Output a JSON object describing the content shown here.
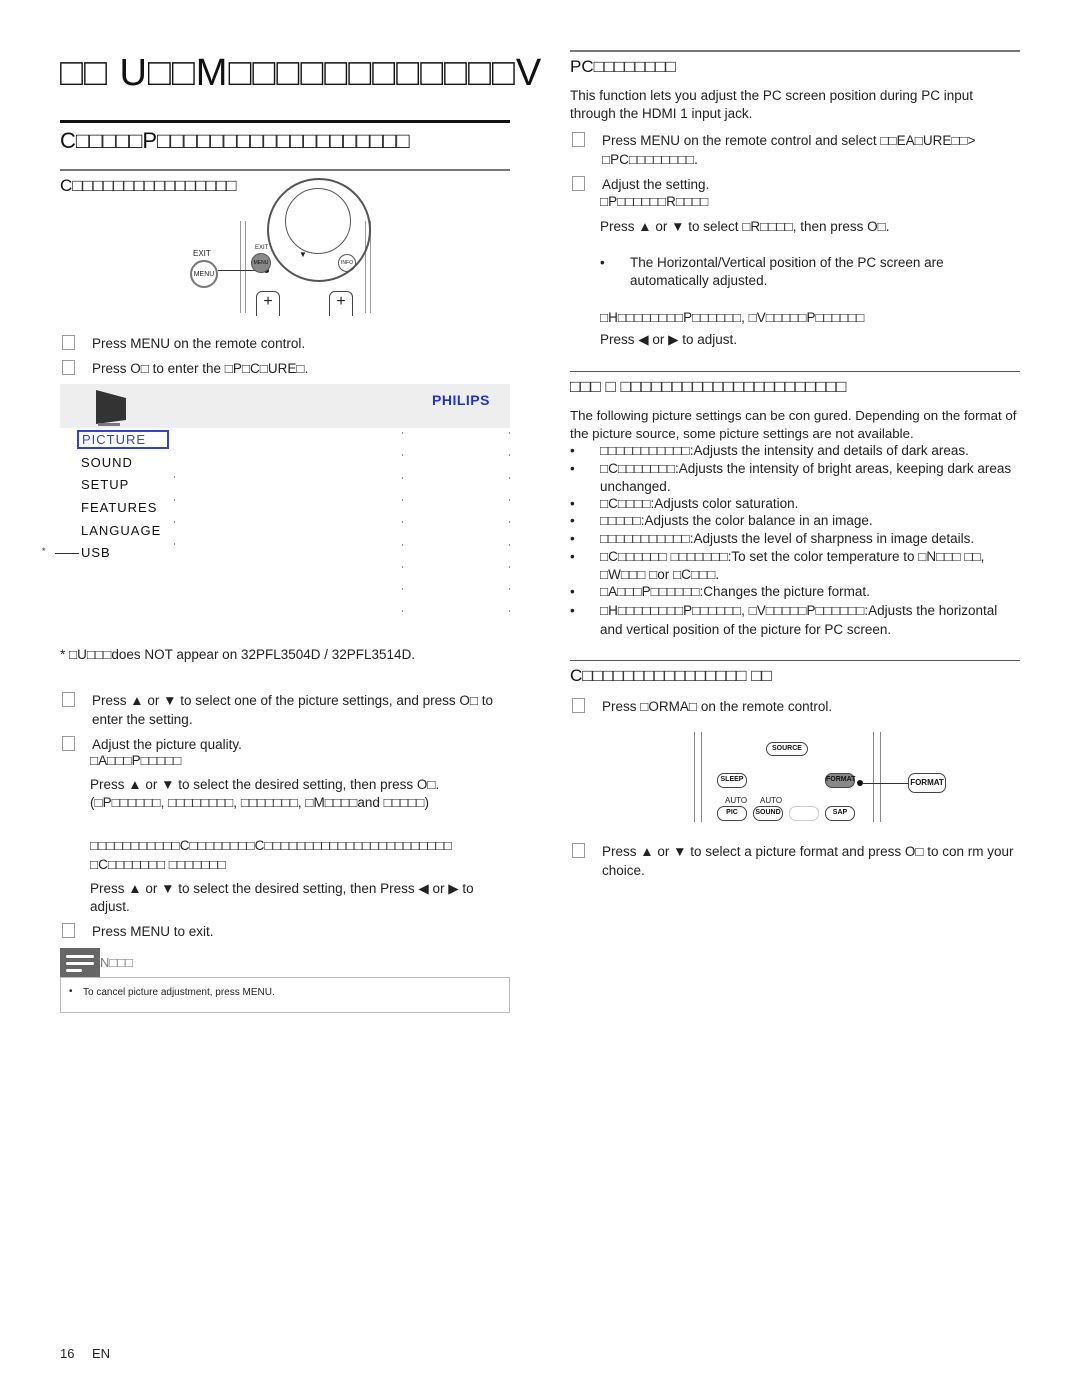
{
  "page": {
    "title": "□□ U□□M□□□□□□□□□□□□V",
    "footer_page": "16",
    "footer_lang": "EN"
  },
  "left": {
    "section_title": "C□□□□□P□□□□□□□□□□□□□□□□□□□",
    "subsection_title": "C□□□□□□□□□□□□□□□□",
    "remote1": {
      "exit_outer": "EXIT",
      "menu_outer": "MENU",
      "exit_inner": "EXIT",
      "menu_inner": "MENU",
      "info": "INFO",
      "down_arrow": "▼",
      "plus": "+"
    },
    "steps_a": [
      "Press MENU on the remote control.",
      "Press O□ to enter the □P□C□URE□."
    ],
    "menu": {
      "brand": "PHILIPS",
      "items": [
        "PICTURE",
        "SOUND",
        "SETUP",
        "FEATURES",
        "LANGUAGE",
        "USB"
      ],
      "selected": "PICTURE",
      "usb_marker": "*",
      "accent": "#3344cc"
    },
    "usb_footnote": "* □U□□□does NOT appear on 32PFL3504D / 32PFL3514D.",
    "steps_b": [
      "Press ▲ or ▼ to select one of the picture settings, and press O□ to enter the setting.",
      "Adjust the picture quality."
    ],
    "auto_picture_label": "□A□□□P□□□□□",
    "auto_picture_text": "Press ▲ or ▼ to select the desired setting, then press O□.",
    "auto_picture_options": "(□P□□□□□□, □□□□□□□□, □□□□□□□, □M□□□□and □□□□□)",
    "other_settings_label": "□□□□□□□□□□□C□□□□□□□□C□□□□□□□□□□□□□□□□□□□□□□□",
    "other_settings_label2": "□C□□□□□□□ □□□□□□□",
    "other_settings_text": "Press ▲ or ▼ to select the desired setting, then Press ◀ or ▶ to adjust.",
    "step_exit": "Press MENU to exit.",
    "note_title": "N□□□",
    "note_text": "To cancel picture adjustment, press MENU."
  },
  "right": {
    "pc_title": "PC□□□□□□□□",
    "pc_intro": "This function lets you adjust the PC screen position during PC input through the HDMI 1 input jack.",
    "pc_step1": "Press MENU on the remote control and select □□EA□URE□□> □PC□□□□□□□□.",
    "pc_step2": "Adjust the setting.",
    "pc_reset_label": "□P□□□□□□R□□□□",
    "pc_reset_text": "Press ▲ or ▼ to select □R□□□□, then press O□.",
    "pc_reset_bullet": "The Horizontal/Vertical position of the PC screen are automatically adjusted.",
    "pc_pos_label": "□H□□□□□□□□P□□□□□□, □V□□□□□P□□□□□□",
    "pc_pos_text": "Press ◀ or ▶ to adjust.",
    "more_title": "□□□ □ □□□□□□□□□□□□□□□□□□□□□□",
    "more_intro": "The following picture settings can be con gured. Depending on the format of the picture source, some picture settings are not available.",
    "more_bullets": [
      "□□□□□□□□□□□:Adjusts the intensity and details of dark areas.",
      "□C□□□□□□□:Adjusts the intensity of bright areas, keeping dark areas unchanged.",
      "□C□□□□:Adjusts color saturation.",
      "□□□□□:Adjusts the color balance in an image.",
      "□□□□□□□□□□□:Adjusts the level of sharpness in image details.",
      "□C□□□□□□ □□□□□□□:To set the color temperature to □N□□□ □□, □W□□□ □or □C□□□.",
      "□A□□□P□□□□□□:Changes the picture format.",
      "□H□□□□□□□□P□□□□□□, □V□□□□□P□□□□□□:Adjusts the horizontal and vertical position of the picture for PC screen."
    ],
    "format_title": "C□□□□□□□□□□□□□□□□ □□",
    "format_step1": "Press □ORMA□ on the remote control.",
    "remote2": {
      "source": "SOURCE",
      "sleep": "SLEEP",
      "format": "FORMAT",
      "format_callout": "FORMAT",
      "auto1": "AUTO",
      "auto2": "AUTO",
      "pic": "PIC",
      "sound": "SOUND",
      "sap": "SAP"
    },
    "format_step2": "Press ▲ or ▼ to select a picture format and press O□ to con rm your choice."
  }
}
